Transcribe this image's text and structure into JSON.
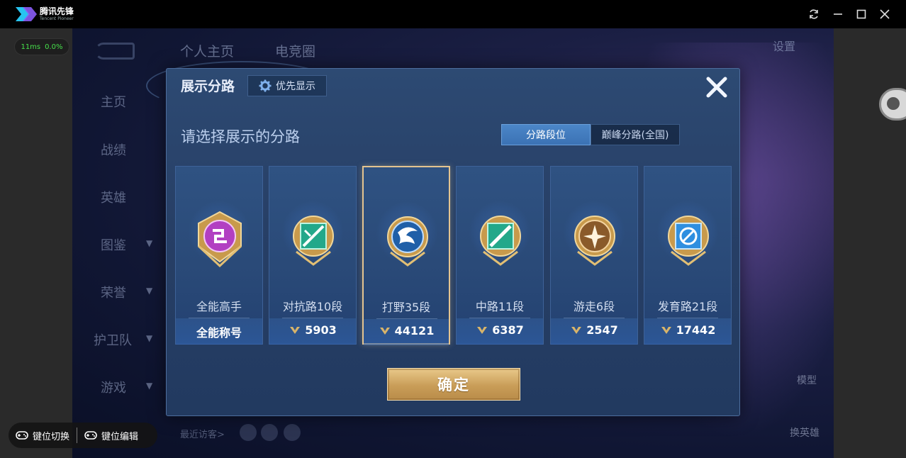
{
  "window": {
    "brand_cn": "腾讯先锋",
    "brand_en": "Tencent Pioneer"
  },
  "perf": {
    "ping": "11ms",
    "loss": "0.0%"
  },
  "background": {
    "tabs": [
      "个人主页",
      "电竞圈"
    ],
    "nav": [
      "主页",
      "战绩",
      "英雄",
      "图鉴",
      "荣誉",
      "护卫队",
      "游戏"
    ],
    "settings_label": "设置",
    "visitor_label": "最近访客>",
    "right_labels": [
      "模型",
      "换英雄"
    ]
  },
  "modal": {
    "title": "展示分路",
    "priority_label": "优先显示",
    "select_prompt": "请选择展示的分路",
    "segments": [
      "分路段位",
      "巅峰分路(全国)"
    ],
    "active_segment": 0,
    "confirm_label": "确定",
    "cards": [
      {
        "name": "全能高手",
        "footer": "全能称号",
        "has_icon": false
      },
      {
        "name": "对抗路10段",
        "footer": "5903",
        "has_icon": true
      },
      {
        "name": "打野35段",
        "footer": "44121",
        "has_icon": true,
        "selected": true
      },
      {
        "name": "中路11段",
        "footer": "6387",
        "has_icon": true
      },
      {
        "name": "游走6段",
        "footer": "2547",
        "has_icon": true
      },
      {
        "name": "发育路21段",
        "footer": "17442",
        "has_icon": true
      }
    ]
  },
  "keybar": {
    "switch_label": "键位切换",
    "edit_label": "键位编辑"
  },
  "colors": {
    "accent_gold": "#e4c490",
    "segment_active": "#4b86c8",
    "ping_green": "#46e04a"
  }
}
